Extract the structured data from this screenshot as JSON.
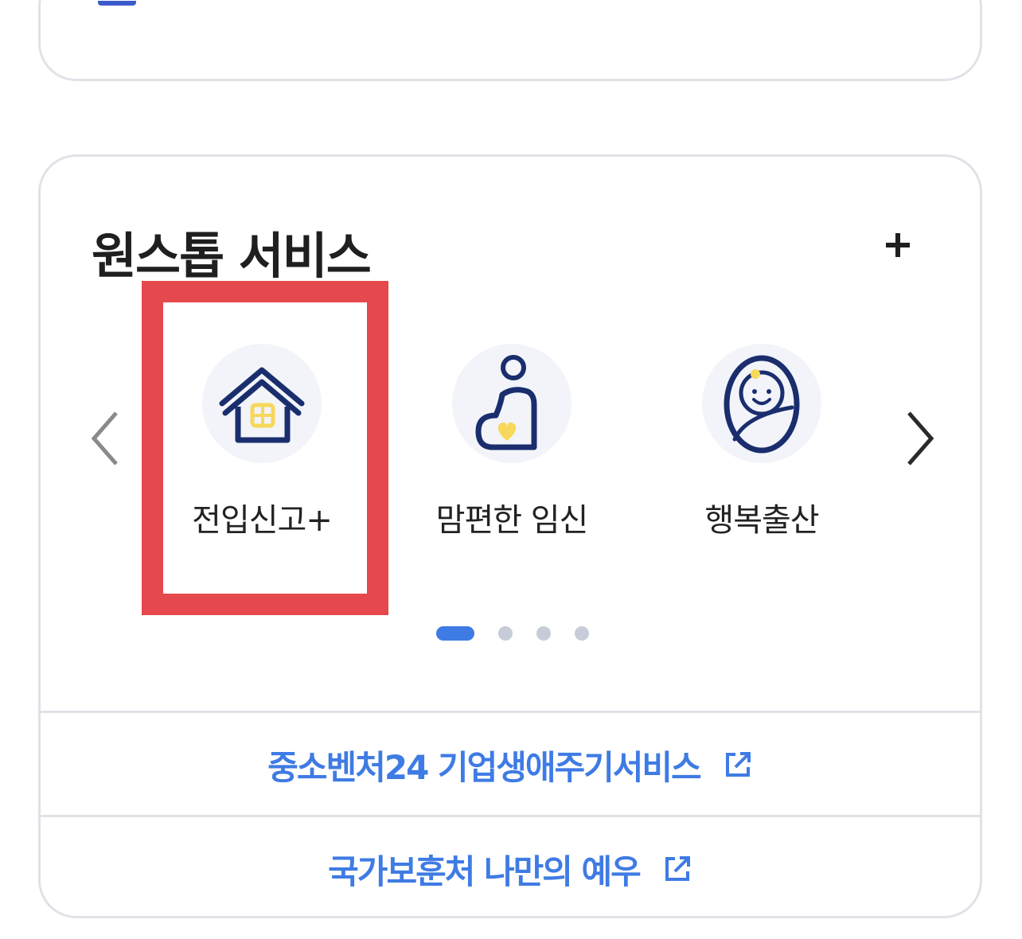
{
  "section": {
    "title": "원스톱 서비스",
    "more_label": "+"
  },
  "services": [
    {
      "label": "전입신고+",
      "icon": "house-icon"
    },
    {
      "label": "맘편한 임신",
      "icon": "pregnancy-icon"
    },
    {
      "label": "행복출산",
      "icon": "baby-icon"
    }
  ],
  "carousel": {
    "page_count": 4,
    "active_page": 1
  },
  "links": [
    {
      "label": "중소벤처24 기업생애주기서비스",
      "icon": "external-link-icon"
    },
    {
      "label": "국가보훈처 나만의 예우",
      "icon": "external-link-icon"
    }
  ],
  "colors": {
    "accent_blue": "#3f7be4",
    "icon_navy": "#1a2e6e",
    "icon_yellow": "#f7d85b",
    "highlight_red": "#e5484d",
    "border": "#e1e2e8"
  }
}
